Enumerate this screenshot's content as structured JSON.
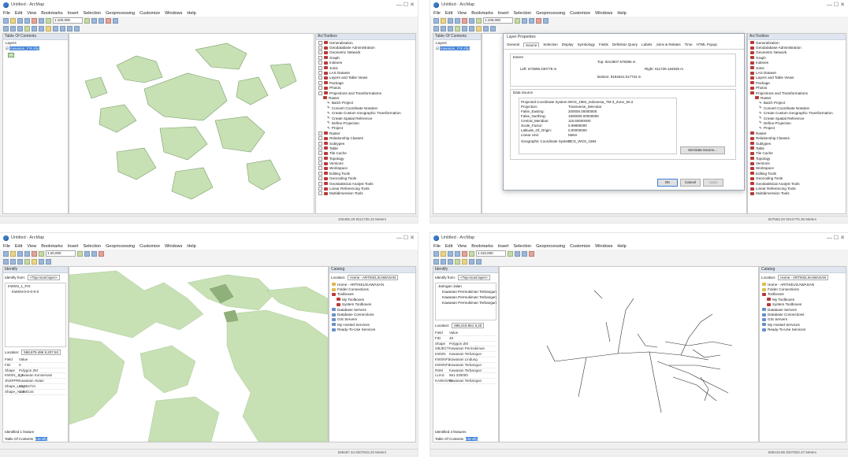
{
  "windows": [
    {
      "title": "Untitled - ArcMap",
      "menu": [
        "File",
        "Edit",
        "View",
        "Bookmarks",
        "Insert",
        "Selection",
        "Geoprocessing",
        "Customize",
        "Windows",
        "Help"
      ],
      "scale": "1:100,000",
      "toc_title": "Table Of Contents",
      "toc_layers": "Layers",
      "toc_layer": "Kawasan_FIX.shp",
      "toolbox_title": "ArcToolbox",
      "toolbox_items": [
        "Generalization",
        "Geodatabase Administration",
        "Geometric Network",
        "Graph",
        "Indexes",
        "Joins",
        "LAS Dataset",
        "Layers and Table Views",
        "Package",
        "Photos",
        "Projections and Transformations",
        "Raster",
        "Batch Project",
        "Convert Coordinate Notation",
        "Create Custom Geographic Transformation",
        "Create Spatial Reference",
        "Define Projection",
        "Project",
        "Raster",
        "Relationship Classes",
        "Subtypes",
        "Table",
        "Tile Cache",
        "Topology",
        "Versions",
        "Workspace",
        "Editing Tools",
        "Geocoding Tools",
        "Geostatistical Analyst Tools",
        "Linear Referencing Tools",
        "Multidimension Tools"
      ],
      "status": "106485.49  9211735.32 Meters"
    },
    {
      "title": "Untitled - ArcMap",
      "menu": [
        "File",
        "Edit",
        "View",
        "Bookmarks",
        "Insert",
        "Selection",
        "Geoprocessing",
        "Customize",
        "Windows",
        "Help"
      ],
      "scale": "1:100,000",
      "toc_title": "Table Of Contents",
      "toc_layers": "Layers",
      "toc_layer": "Kawasan_FIX.shp",
      "dialog": {
        "title": "Layer Properties",
        "tabs": [
          "General",
          "Source",
          "Selection",
          "Display",
          "Symbology",
          "Fields",
          "Definition Query",
          "Labels",
          "Joins & Relates",
          "Time",
          "HTML Popup"
        ],
        "extent_label": "Extent",
        "extent_top": "Top: 9213607.678395 m",
        "extent_left": "Left: 573696.230779 m",
        "extent_right": "Right: 611728.184835 m",
        "extent_bottom": "Bottom: 9184631.517724 m",
        "source_label": "Data Source",
        "rows": [
          [
            "Projected Coordinate System:",
            "WGS_1984_Indonesia_TM-3_Zone_50.2"
          ],
          [
            "Projection:",
            "Transverse_Mercator"
          ],
          [
            "False_Easting:",
            "200000.00000000"
          ],
          [
            "False_Northing:",
            "1500000.00000000"
          ],
          [
            "Central_Meridian:",
            "115.50000000"
          ],
          [
            "Scale_Factor:",
            "0.99990000"
          ],
          [
            "Latitude_Of_Origin:",
            "0.00000000"
          ],
          [
            "Linear Unit:",
            "Meter"
          ],
          [
            "Geographic Coordinate System:",
            "GCS_WGS_1984"
          ]
        ],
        "set_source": "Set Data Source...",
        "ok": "OK",
        "cancel": "Cancel",
        "apply": "Apply"
      },
      "toolbox_title": "ArcToolbox",
      "toolbox_items": [
        "Generalization",
        "Geodatabase Administration",
        "Geometric Network",
        "Graph",
        "Indexes",
        "Joins",
        "LAS Dataset",
        "Layers and Table Views",
        "Package",
        "Photos",
        "Projections and Transformations",
        "Raster",
        "Batch Project",
        "Convert Coordinate Notation",
        "Create Custom Geographic Transformation",
        "Create Spatial Reference",
        "Define Projection",
        "Project",
        "Raster",
        "Relationship Classes",
        "Subtypes",
        "Table",
        "Tile Cache",
        "Topology",
        "Versions",
        "Workspace",
        "Editing Tools",
        "Geocoding Tools",
        "Geostatistical Analyst Tools",
        "Linear Referencing Tools",
        "Multidimension Tools"
      ],
      "status": "607563.20  9212775.36 Meters"
    },
    {
      "title": "Untitled - ArcMap",
      "menu": [
        "File",
        "Edit",
        "View",
        "Bookmarks",
        "Insert",
        "Selection",
        "Geoprocessing",
        "Customize",
        "Windows",
        "Help"
      ],
      "scale": "1:20,000",
      "identify_title": "Identify",
      "identify_from": "Identify from:",
      "identify_layer": "<Top-most layer>",
      "identify_tree": [
        "KWSN_1_FIX",
        "KWSN-0-0-0-0-0"
      ],
      "location_label": "Location:",
      "location_value": "598,875.486 9,207,93",
      "attrs": [
        [
          "Field",
          "Value"
        ],
        [
          "FID",
          "0"
        ],
        [
          "Shape",
          "Polygon ZM"
        ],
        [
          "KWSN_1_2",
          "Kawasan Konservasi"
        ],
        [
          "JNSRPR",
          "Kawasan Hutan"
        ],
        [
          "Shape_Leng",
          "12.354721"
        ],
        [
          "Shape_Area",
          "1.260144"
        ]
      ],
      "identified": "Identified 1 feature",
      "catalog_title": "Catalog",
      "catalog_location": "Location:",
      "catalog_path": "Home - ARTIKEL\\KAWASAN",
      "catalog_items": [
        "Home - ARTIKEL\\KAWASAN",
        "Folder Connections",
        "Toolboxes",
        "My Toolboxes",
        "System Toolboxes",
        "Database Servers",
        "Database Connections",
        "GIS Servers",
        "My Hosted Services",
        "Ready-To-Use Services"
      ],
      "tabs": [
        "Table Of Contents",
        "Identify"
      ],
      "status": "599487.34  9207815.20 Meters"
    },
    {
      "title": "Untitled - ArcMap",
      "menu": [
        "File",
        "Edit",
        "View",
        "Bookmarks",
        "Insert",
        "Selection",
        "Geoprocessing",
        "Customize",
        "Windows",
        "Help"
      ],
      "scale": "1:110,000",
      "identify_title": "Identify",
      "identify_from": "Identify from:",
      "identify_layer": "<Top-most layer>",
      "identify_tree": [
        "Jaringan Jalan",
        "Kawasan Permukiman Terbangun",
        "Kawasan Permukiman Terbangun",
        "Kawasan Permukiman Terbangun"
      ],
      "location_label": "Location:",
      "location_value": "598,419.961 9,20",
      "attrs": [
        [
          "Field",
          "Value"
        ],
        [
          "FID",
          "48"
        ],
        [
          "Shape",
          "Polygon ZM"
        ],
        [
          "OBJECT",
          "Kawasan Permukiman"
        ],
        [
          "KWSN",
          "Kawasan Terbangun"
        ],
        [
          "KWSNF1",
          "Kawasan Lindung"
        ],
        [
          "KWSNF2",
          "Kawasan Terbangun"
        ],
        [
          "RSM",
          "Kawasan Terbangun"
        ],
        [
          "LUAS",
          "861.330000"
        ],
        [
          "KAWASAN",
          "Kawasan Terbangun"
        ]
      ],
      "identified": "Identified 4 features",
      "catalog_title": "Catalog",
      "catalog_location": "Location:",
      "catalog_path": "Home - ARTIKEL\\KAWASAN",
      "catalog_items": [
        "Home - ARTIKEL\\KAWASAN",
        "Folder Connections",
        "Toolboxes",
        "My Toolboxes",
        "System Toolboxes",
        "Database Servers",
        "Database Connections",
        "GIS Servers",
        "My Hosted Services",
        "Ready-To-Use Services"
      ],
      "tabs": [
        "Table Of Contents",
        "Identify"
      ],
      "status": "598419.96  9207803.37 Meters"
    }
  ],
  "colors": {
    "polygon_fill": "#c7e0b4",
    "polygon_stroke": "#7a9d6a",
    "selection": "#3c7fd6",
    "road": "#2a2a2a"
  }
}
